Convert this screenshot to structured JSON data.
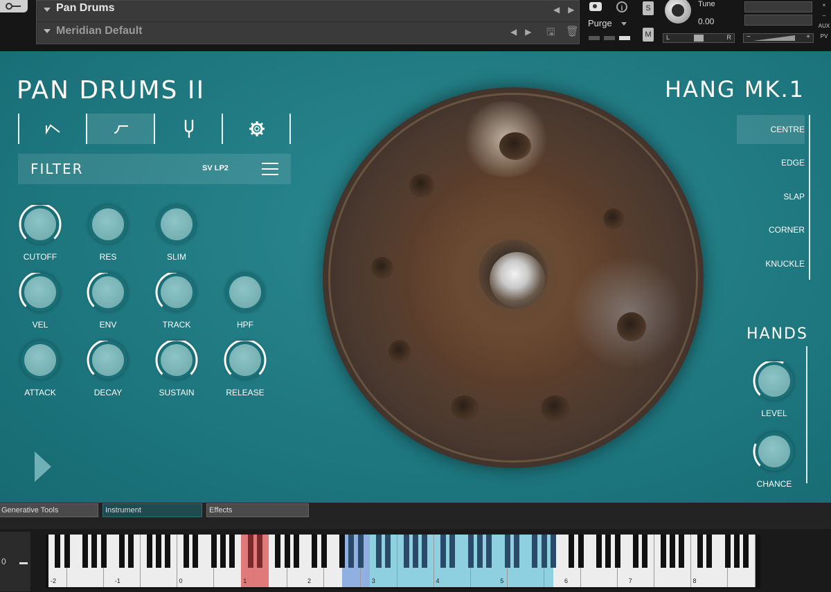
{
  "header": {
    "instrument_name": "Pan Drums",
    "snapshot_name": "Meridian Default",
    "purge_label": "Purge",
    "solo_label": "S",
    "mute_label": "M",
    "tune_label": "Tune",
    "tune_value": "0.00",
    "pan_left": "L",
    "pan_right": "R",
    "vol_minus": "−",
    "vol_plus": "+",
    "aux_label": "AUX",
    "pv_label": "PV"
  },
  "main": {
    "title": "PAN DRUMS II",
    "drum_title": "HANG MK.1",
    "tabs": [
      "envelope-icon",
      "filter-icon",
      "tuning-fork-icon",
      "gear-icon"
    ],
    "selected_tab": 1,
    "filter_label": "FILTER",
    "filter_type": "SV LP2",
    "knobs": [
      {
        "label": "CUTOFF",
        "value": 1.0
      },
      {
        "label": "RES",
        "value": 0.0
      },
      {
        "label": "SLIM",
        "value": 0.0
      },
      {
        "label": "VEL",
        "value": 0.5
      },
      {
        "label": "ENV",
        "value": 0.5
      },
      {
        "label": "TRACK",
        "value": 0.5
      },
      {
        "label": "HPF",
        "value": 0.0
      },
      {
        "label": "ATTACK",
        "value": 0.0
      },
      {
        "label": "DECAY",
        "value": 0.5
      },
      {
        "label": "SUSTAIN",
        "value": 1.0
      },
      {
        "label": "RELEASE",
        "value": 1.0
      }
    ],
    "articulations": [
      "CENTRE",
      "EDGE",
      "SLAP",
      "CORNER",
      "KNUCKLE"
    ],
    "selected_articulation": 0,
    "hands_title": "HANDS",
    "hands_knobs": [
      {
        "label": "LEVEL",
        "value": 0.6
      },
      {
        "label": "CHANCE",
        "value": 0.25
      }
    ]
  },
  "footer": {
    "tabs": [
      "Generative Tools",
      "Instrument",
      "Effects"
    ],
    "selected_tab": 1,
    "keyboard_left_value": "0",
    "octave_labels": [
      "-2",
      "-1",
      "0",
      "1",
      "2",
      "3",
      "4",
      "5",
      "6",
      "7",
      "8"
    ]
  },
  "colors": {
    "panel_teal": "#1f7880",
    "keyswitch_red": "#e07a7a",
    "range_blue": "#8fb0e0",
    "range_cyan": "#8fd0e0"
  }
}
